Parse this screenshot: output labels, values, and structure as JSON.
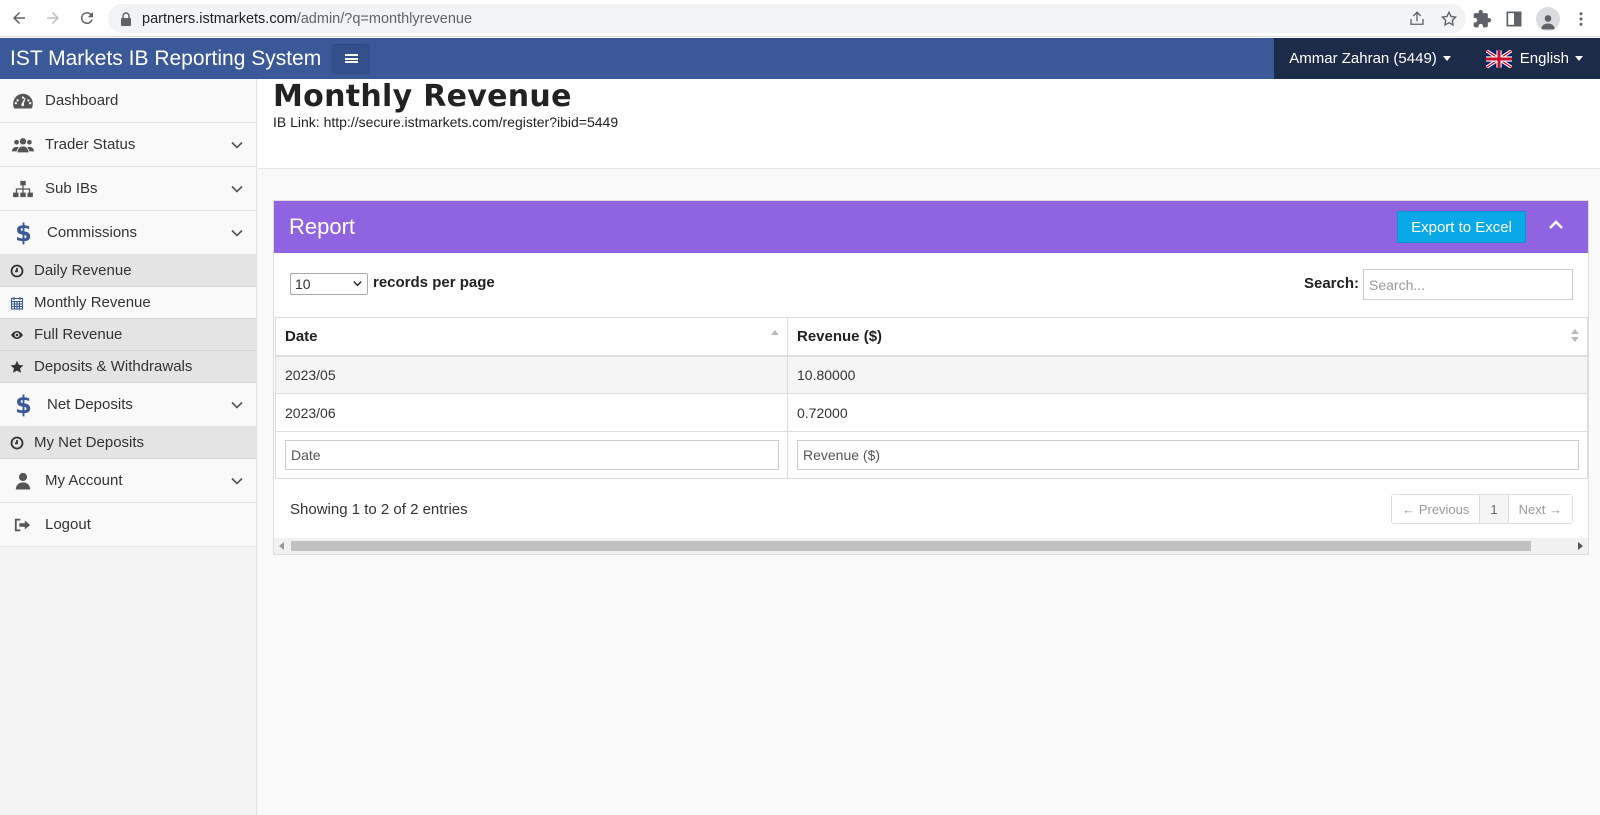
{
  "browser": {
    "url_host": "partners.istmarkets.com",
    "url_path": "/admin/?q=monthlyrevenue"
  },
  "header": {
    "brand": "IST Markets IB Reporting System",
    "user": "Ammar Zahran (5449)",
    "language": "English"
  },
  "sidebar": {
    "items": [
      {
        "label": "Dashboard",
        "icon": "dashboard-icon"
      },
      {
        "label": "Trader Status",
        "icon": "users-icon"
      },
      {
        "label": "Sub IBs",
        "icon": "sitemap-icon"
      },
      {
        "label": "Commissions",
        "icon": "dollar-icon"
      },
      {
        "label": "Net Deposits",
        "icon": "dollar-icon"
      },
      {
        "label": "My Account",
        "icon": "user-icon"
      },
      {
        "label": "Logout",
        "icon": "logout-icon"
      }
    ],
    "commissions_sub": [
      {
        "label": "Daily Revenue",
        "icon": "clock-icon"
      },
      {
        "label": "Monthly Revenue",
        "icon": "calendar-icon"
      },
      {
        "label": "Full Revenue",
        "icon": "eye-icon"
      },
      {
        "label": "Deposits & Withdrawals",
        "icon": "star-icon"
      }
    ],
    "net_deposits_sub": [
      {
        "label": "My Net Deposits",
        "icon": "clock-icon"
      }
    ]
  },
  "page": {
    "title": "Monthly Revenue",
    "ib_link": "IB Link: http://secure.istmarkets.com/register?ibid=5449"
  },
  "report": {
    "title": "Report",
    "export_label": "Export to Excel",
    "page_length": "10",
    "length_label": "records per page",
    "search_label": "Search:",
    "search_placeholder": "Search...",
    "columns": [
      "Date",
      "Revenue ($)"
    ],
    "rows": [
      [
        "2023/05",
        "10.80000"
      ],
      [
        "2023/06",
        "0.72000"
      ]
    ],
    "filter_placeholders": [
      "Date",
      "Revenue ($)"
    ],
    "info": "Showing 1 to 2 of 2 entries",
    "pager": {
      "prev": "← Previous",
      "current": "1",
      "next": "Next →"
    }
  },
  "colors": {
    "header_bg": "#3b5998",
    "user_bg": "#1c2b48",
    "panel_head": "#9064e0",
    "export_btn": "#0aa8e6"
  }
}
